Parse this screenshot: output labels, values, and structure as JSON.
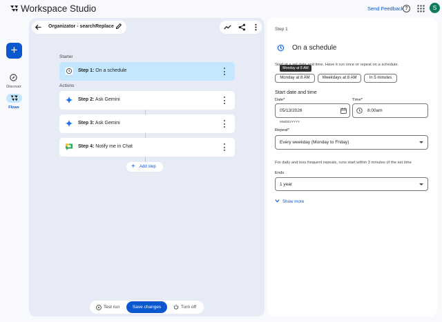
{
  "app": {
    "title": "Workspace Studio"
  },
  "header": {
    "send_feedback": "Send Feedback",
    "avatar_letter": "S"
  },
  "rail": {
    "new_label": "+",
    "discover": "Discover",
    "flows": "Flows"
  },
  "flow": {
    "title": "Organizator - searchReplace"
  },
  "canvas": {
    "starter_label": "Starter",
    "actions_label": "Actions",
    "steps": [
      {
        "num": "Step 1:",
        "name": "On a schedule"
      },
      {
        "num": "Step 2:",
        "name": "Ask Gemini"
      },
      {
        "num": "Step 3:",
        "name": "Ask Gemini"
      },
      {
        "num": "Step 4:",
        "name": "Notify me in Chat"
      }
    ],
    "add_step": "Add step"
  },
  "bottom": {
    "test_run": "Test run",
    "save_changes": "Save changes",
    "turn_off": "Turn off"
  },
  "panel": {
    "step_label": "Step 1",
    "title": "On a schedule",
    "description": "Start at a set date and time. Have it run once or repeat on a schedule.",
    "tooltip": "Monday at 8 AM",
    "presets": [
      "Monday at 8 AM",
      "Weekdays at 8 AM",
      "In 5 minutes"
    ],
    "start_heading": "Start date and time",
    "date_label": "Date*",
    "date_value": "05/13/2026",
    "date_hint": "MM/DD/YYYY",
    "time_label": "Time*",
    "time_value": "8:00am",
    "repeat_label": "Repeat*",
    "repeat_value": "Every weekday (Monday to Friday)",
    "repeat_note": "For daily and less frequent repeats, runs start within 3 minutes of the set time",
    "ends_label": "Ends",
    "ends_value": "1 year",
    "show_more": "Show more"
  },
  "colors": {
    "accent": "#0b57d0",
    "active_step": "#c2e7ff",
    "canvas_bg": "#e6ebf5"
  },
  "icons": [
    "logo-icon",
    "help-icon",
    "apps-grid-icon",
    "back-arrow-icon",
    "pencil-icon",
    "trend-icon",
    "share-icon",
    "more-vert-icon",
    "clock-icon",
    "gemini-sparkle-icon",
    "google-chat-icon",
    "calendar-icon",
    "power-icon"
  ]
}
